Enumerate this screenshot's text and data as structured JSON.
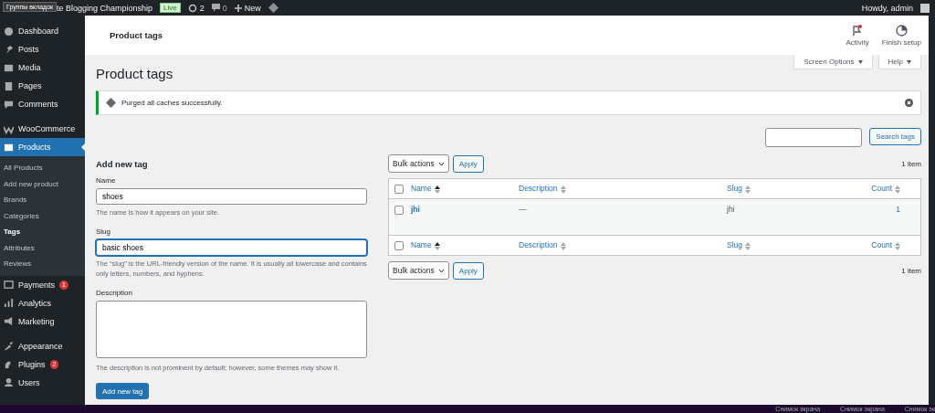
{
  "admin_bar": {
    "tooltip": "Группы вкладок",
    "site_title": "te Blogging Championship",
    "live_badge": "Live",
    "updates": "2",
    "comments": "0",
    "new_label": "New",
    "greeting": "Howdy, admin"
  },
  "sidebar": {
    "items": [
      {
        "label": "Dashboard",
        "selected": false
      },
      {
        "label": "Posts",
        "selected": false
      },
      {
        "label": "Media",
        "selected": false
      },
      {
        "label": "Pages",
        "selected": false
      },
      {
        "label": "Comments",
        "selected": false
      },
      {
        "label": "WooCommerce",
        "selected": false
      },
      {
        "label": "Products",
        "selected": true,
        "children": [
          {
            "label": "All Products",
            "selected": false
          },
          {
            "label": "Add new product",
            "selected": false
          },
          {
            "label": "Brands",
            "selected": false
          },
          {
            "label": "Categories",
            "selected": false
          },
          {
            "label": "Tags",
            "selected": true
          },
          {
            "label": "Attributes",
            "selected": false
          },
          {
            "label": "Reviews",
            "selected": false
          }
        ]
      },
      {
        "label": "Payments",
        "selected": false,
        "badge": "1"
      },
      {
        "label": "Analytics",
        "selected": false
      },
      {
        "label": "Marketing",
        "selected": false
      },
      {
        "label": "Appearance",
        "selected": false
      },
      {
        "label": "Plugins",
        "selected": false,
        "badge": "2"
      },
      {
        "label": "Users",
        "selected": false
      }
    ]
  },
  "header": {
    "title": "Product tags",
    "actions": [
      {
        "label": "Activity",
        "notification": true
      },
      {
        "label": "Finish setup",
        "notification": false
      }
    ]
  },
  "screen_tabs": [
    "Screen Options",
    "Help"
  ],
  "page_title": "Product tags",
  "notice": {
    "text": "Purged all caches successfully."
  },
  "search": {
    "button": "Search tags"
  },
  "form": {
    "heading": "Add new tag",
    "fields": [
      {
        "kind": "text",
        "label": "Name",
        "value": "shoes",
        "focused": false,
        "hint": "The name is how it appears on your site."
      },
      {
        "kind": "text",
        "label": "Slug",
        "value": "basic shoes",
        "focused": true,
        "hint": "The “slug” is the URL-friendly version of the name. It is usually all lowercase and contains only letters, numbers, and hyphens."
      },
      {
        "kind": "textarea",
        "label": "Description",
        "focused": false,
        "hint": "The description is not prominent by default; however, some themes may show it."
      }
    ],
    "submit": "Add new tag"
  },
  "table": {
    "top_nav": {
      "bulk_actions": "Bulk actions",
      "apply": "Apply",
      "count": "1 item"
    },
    "bottom_nav": {
      "bulk_actions": "Bulk actions",
      "apply": "Apply",
      "count": "1 item"
    },
    "header_checked": false,
    "footer_checked": false,
    "columns": [
      {
        "label": "Name",
        "sorted": true
      },
      {
        "label": "Description",
        "sorted": false
      },
      {
        "label": "Slug",
        "sorted": false
      },
      {
        "label": "Count",
        "sorted": false
      }
    ],
    "footer_columns": [
      {
        "label": "Name",
        "sorted": true
      },
      {
        "label": "Description",
        "sorted": false
      },
      {
        "label": "Slug",
        "sorted": false
      },
      {
        "label": "Count",
        "sorted": false
      }
    ],
    "rows": [
      {
        "checked": false,
        "name": "jhi",
        "description": "—",
        "slug": "jhi",
        "count": "1"
      }
    ]
  },
  "taskbar": [
    "Снимок экрана",
    "Снимок экрана",
    "Снимок эк"
  ]
}
